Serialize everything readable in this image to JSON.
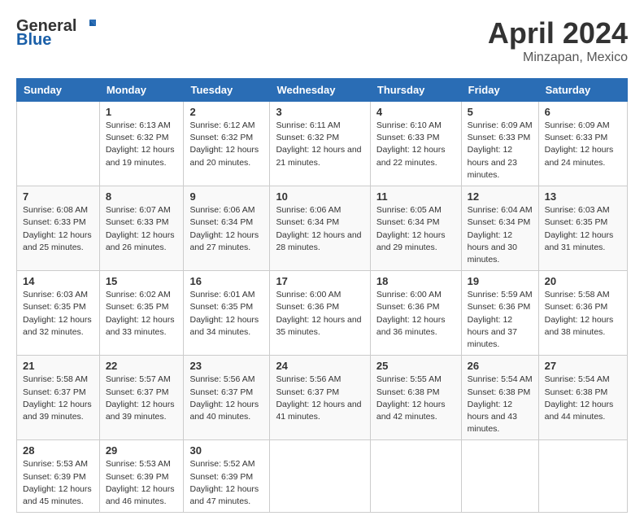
{
  "header": {
    "logo_general": "General",
    "logo_blue": "Blue",
    "title": "April 2024",
    "location": "Minzapan, Mexico"
  },
  "days_of_week": [
    "Sunday",
    "Monday",
    "Tuesday",
    "Wednesday",
    "Thursday",
    "Friday",
    "Saturday"
  ],
  "weeks": [
    [
      {
        "day": "",
        "info": ""
      },
      {
        "day": "1",
        "info": "Sunrise: 6:13 AM\nSunset: 6:32 PM\nDaylight: 12 hours\nand 19 minutes."
      },
      {
        "day": "2",
        "info": "Sunrise: 6:12 AM\nSunset: 6:32 PM\nDaylight: 12 hours\nand 20 minutes."
      },
      {
        "day": "3",
        "info": "Sunrise: 6:11 AM\nSunset: 6:32 PM\nDaylight: 12 hours\nand 21 minutes."
      },
      {
        "day": "4",
        "info": "Sunrise: 6:10 AM\nSunset: 6:33 PM\nDaylight: 12 hours\nand 22 minutes."
      },
      {
        "day": "5",
        "info": "Sunrise: 6:09 AM\nSunset: 6:33 PM\nDaylight: 12 hours\nand 23 minutes."
      },
      {
        "day": "6",
        "info": "Sunrise: 6:09 AM\nSunset: 6:33 PM\nDaylight: 12 hours\nand 24 minutes."
      }
    ],
    [
      {
        "day": "7",
        "info": "Sunrise: 6:08 AM\nSunset: 6:33 PM\nDaylight: 12 hours\nand 25 minutes."
      },
      {
        "day": "8",
        "info": "Sunrise: 6:07 AM\nSunset: 6:33 PM\nDaylight: 12 hours\nand 26 minutes."
      },
      {
        "day": "9",
        "info": "Sunrise: 6:06 AM\nSunset: 6:34 PM\nDaylight: 12 hours\nand 27 minutes."
      },
      {
        "day": "10",
        "info": "Sunrise: 6:06 AM\nSunset: 6:34 PM\nDaylight: 12 hours\nand 28 minutes."
      },
      {
        "day": "11",
        "info": "Sunrise: 6:05 AM\nSunset: 6:34 PM\nDaylight: 12 hours\nand 29 minutes."
      },
      {
        "day": "12",
        "info": "Sunrise: 6:04 AM\nSunset: 6:34 PM\nDaylight: 12 hours\nand 30 minutes."
      },
      {
        "day": "13",
        "info": "Sunrise: 6:03 AM\nSunset: 6:35 PM\nDaylight: 12 hours\nand 31 minutes."
      }
    ],
    [
      {
        "day": "14",
        "info": "Sunrise: 6:03 AM\nSunset: 6:35 PM\nDaylight: 12 hours\nand 32 minutes."
      },
      {
        "day": "15",
        "info": "Sunrise: 6:02 AM\nSunset: 6:35 PM\nDaylight: 12 hours\nand 33 minutes."
      },
      {
        "day": "16",
        "info": "Sunrise: 6:01 AM\nSunset: 6:35 PM\nDaylight: 12 hours\nand 34 minutes."
      },
      {
        "day": "17",
        "info": "Sunrise: 6:00 AM\nSunset: 6:36 PM\nDaylight: 12 hours\nand 35 minutes."
      },
      {
        "day": "18",
        "info": "Sunrise: 6:00 AM\nSunset: 6:36 PM\nDaylight: 12 hours\nand 36 minutes."
      },
      {
        "day": "19",
        "info": "Sunrise: 5:59 AM\nSunset: 6:36 PM\nDaylight: 12 hours\nand 37 minutes."
      },
      {
        "day": "20",
        "info": "Sunrise: 5:58 AM\nSunset: 6:36 PM\nDaylight: 12 hours\nand 38 minutes."
      }
    ],
    [
      {
        "day": "21",
        "info": "Sunrise: 5:58 AM\nSunset: 6:37 PM\nDaylight: 12 hours\nand 39 minutes."
      },
      {
        "day": "22",
        "info": "Sunrise: 5:57 AM\nSunset: 6:37 PM\nDaylight: 12 hours\nand 39 minutes."
      },
      {
        "day": "23",
        "info": "Sunrise: 5:56 AM\nSunset: 6:37 PM\nDaylight: 12 hours\nand 40 minutes."
      },
      {
        "day": "24",
        "info": "Sunrise: 5:56 AM\nSunset: 6:37 PM\nDaylight: 12 hours\nand 41 minutes."
      },
      {
        "day": "25",
        "info": "Sunrise: 5:55 AM\nSunset: 6:38 PM\nDaylight: 12 hours\nand 42 minutes."
      },
      {
        "day": "26",
        "info": "Sunrise: 5:54 AM\nSunset: 6:38 PM\nDaylight: 12 hours\nand 43 minutes."
      },
      {
        "day": "27",
        "info": "Sunrise: 5:54 AM\nSunset: 6:38 PM\nDaylight: 12 hours\nand 44 minutes."
      }
    ],
    [
      {
        "day": "28",
        "info": "Sunrise: 5:53 AM\nSunset: 6:39 PM\nDaylight: 12 hours\nand 45 minutes."
      },
      {
        "day": "29",
        "info": "Sunrise: 5:53 AM\nSunset: 6:39 PM\nDaylight: 12 hours\nand 46 minutes."
      },
      {
        "day": "30",
        "info": "Sunrise: 5:52 AM\nSunset: 6:39 PM\nDaylight: 12 hours\nand 47 minutes."
      },
      {
        "day": "",
        "info": ""
      },
      {
        "day": "",
        "info": ""
      },
      {
        "day": "",
        "info": ""
      },
      {
        "day": "",
        "info": ""
      }
    ]
  ]
}
